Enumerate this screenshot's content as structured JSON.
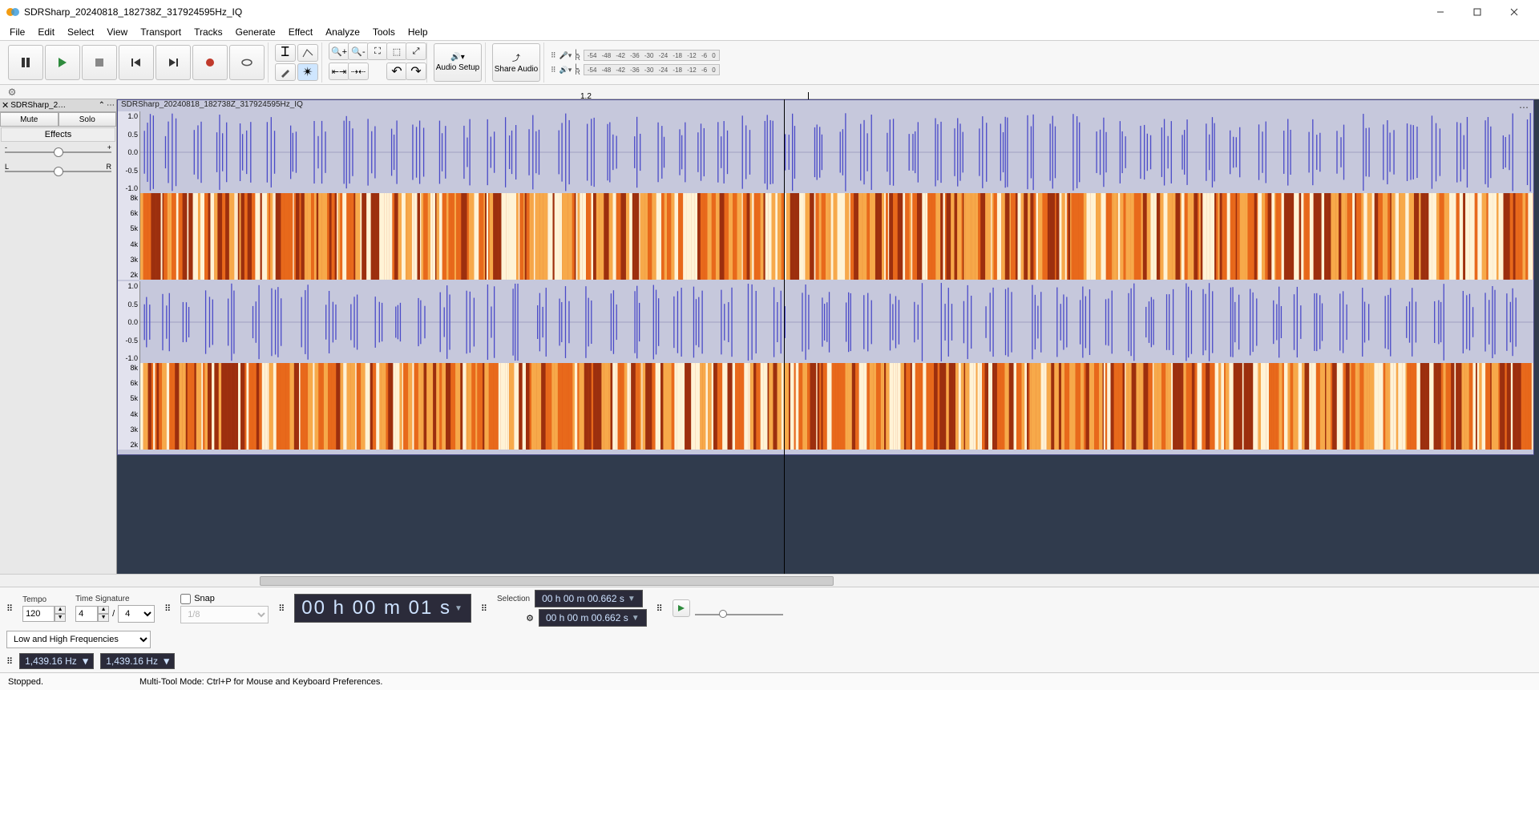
{
  "window": {
    "title": "SDRSharp_20240818_182738Z_317924595Hz_IQ"
  },
  "menu": [
    "File",
    "Edit",
    "Select",
    "View",
    "Transport",
    "Tracks",
    "Generate",
    "Effect",
    "Analyze",
    "Tools",
    "Help"
  ],
  "meter_ticks": [
    "-54",
    "-48",
    "-42",
    "-36",
    "-30",
    "-24",
    "-18",
    "-12",
    "-6",
    "0"
  ],
  "timeline": {
    "label": "1.2"
  },
  "track": {
    "name": "SDRSharp_2…",
    "full_name": "SDRSharp_20240818_182738Z_317924595Hz_IQ",
    "mute": "Mute",
    "solo": "Solo",
    "effects": "Effects",
    "gain_minus": "-",
    "gain_plus": "+",
    "pan_l": "L",
    "pan_r": "R",
    "wave_ticks": [
      "1.0",
      "0.5",
      "0.0",
      "-0.5",
      "-1.0"
    ],
    "spec_ticks": [
      "8k",
      "6k",
      "5k",
      "4k",
      "3k",
      "2k"
    ]
  },
  "toolbar": {
    "audio_setup": "Audio Setup",
    "share_audio": "Share Audio",
    "meter_LR": [
      "L",
      "R"
    ]
  },
  "bottom": {
    "tempo_label": "Tempo",
    "tempo_value": "120",
    "timesig_label": "Time Signature",
    "timesig_num": "4",
    "timesig_sep": "/",
    "timesig_den": "4",
    "snap_label": "Snap",
    "snap_value": "1/8",
    "main_time": "00 h 00 m 01 s",
    "selection_label": "Selection",
    "sel_start": "00 h 00 m 00.662 s",
    "sel_end": "00 h 00 m 00.662 s",
    "filter_label": "Low and High Frequencies",
    "freq_low": "1,439.16 Hz",
    "freq_high": "1,439.16 Hz"
  },
  "status": {
    "state": "Stopped.",
    "hint": "Multi-Tool Mode: Ctrl+P for Mouse and Keyboard Preferences."
  }
}
